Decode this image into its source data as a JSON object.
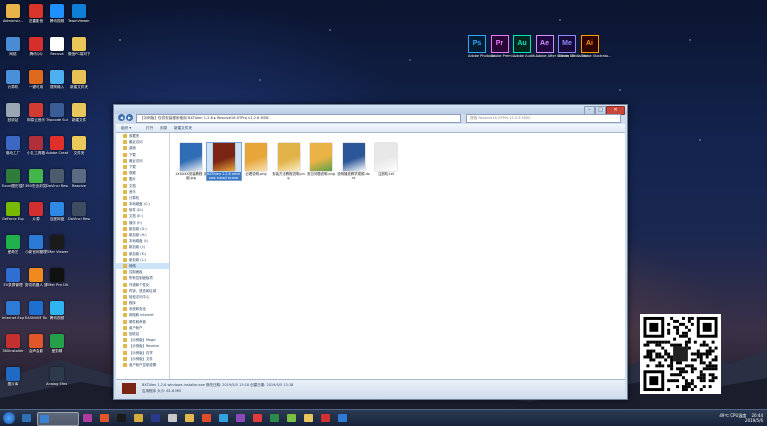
{
  "desktop": {
    "icons": [
      {
        "label": "Administr...",
        "color": "#e8b44a"
      },
      {
        "label": "迅雷影音",
        "color": "#d8342a"
      },
      {
        "label": "腾讯视频",
        "color": "#1e90ff"
      },
      {
        "label": "TeamViewer 14",
        "color": "#0e7fd6"
      },
      {
        "label": "网络",
        "color": "#4b8bd4"
      },
      {
        "label": "腾讯QQ",
        "color": "#d62d2d"
      },
      {
        "label": "Recuva",
        "color": "#ffffff"
      },
      {
        "label": "微信PC端可下载",
        "color": "#e8c657"
      },
      {
        "label": "计算机",
        "color": "#4a90d9"
      },
      {
        "label": "一键可用",
        "color": "#e06a1c"
      },
      {
        "label": "搜狗输入",
        "color": "#4fb0f0"
      },
      {
        "label": "新建文件夹",
        "color": "#e7c156"
      },
      {
        "label": "回收站",
        "color": "#9aa6b4"
      },
      {
        "label": "网易云音乐",
        "color": "#d13b32"
      },
      {
        "label": "Tripcode Suite 12.1...",
        "color": "#3a5d96"
      },
      {
        "label": "新建文件",
        "color": "#e8c65e"
      },
      {
        "label": "驱动工厂",
        "color": "#3a68c4"
      },
      {
        "label": "小扎工具箱",
        "color": "#b0303a"
      },
      {
        "label": "Adobe Creati...",
        "color": "#e0302c"
      },
      {
        "label": "文件夹",
        "color": "#eac85a"
      },
      {
        "label": "Excel图形插件",
        "color": "#2f7d3b"
      },
      {
        "label": "360安全浏览器",
        "color": "#43b649"
      },
      {
        "label": "DaVinci Resolve",
        "color": "#4e5b6d"
      },
      {
        "label": "Resolve",
        "color": "#5b6b82"
      },
      {
        "label": "GeForce Experience",
        "color": "#76b900"
      },
      {
        "label": "片源",
        "color": "#d23030"
      },
      {
        "label": "百度网盘",
        "color": "#2f8ae6"
      },
      {
        "label": "DaVinci Resol...",
        "color": "#3d4c60"
      },
      {
        "label": "爱奇艺",
        "color": "#20b14a"
      },
      {
        "label": "小新官网管理",
        "color": "#2b7bd6"
      },
      {
        "label": "TMer Viewer...",
        "color": "#1b1b1b"
      },
      {
        "label": "",
        "color": "#00000000"
      },
      {
        "label": "EV录屏管理",
        "color": "#2f6fd1"
      },
      {
        "label": "剪切机器人 媒体下载",
        "color": "#f08a1f"
      },
      {
        "label": "TMer Pro Ultimate",
        "color": "#111111"
      },
      {
        "label": "",
        "color": "#00000000"
      },
      {
        "label": "Internet Explorer",
        "color": "#2d7bd5"
      },
      {
        "label": "EASNVIM Tools Lite",
        "color": "#1d6fd0"
      },
      {
        "label": "腾讯视频",
        "color": "#2fb4f0"
      },
      {
        "label": "",
        "color": "#00000000"
      },
      {
        "label": "360Installer",
        "color": "#c33030"
      },
      {
        "label": "会声会影",
        "color": "#e2572a"
      },
      {
        "label": "爱剪辑",
        "color": "#24a04a"
      },
      {
        "label": "",
        "color": "#00000000"
      },
      {
        "label": "图片库",
        "color": "#1f6bc4"
      },
      {
        "label": "",
        "color": "#00000000"
      },
      {
        "label": "Analog Efex Pro 2",
        "color": "#2d3a4e"
      }
    ],
    "adobe": [
      {
        "abbr": "Ps",
        "label": "Adobe Photosh...",
        "bg": "#001d34",
        "fg": "#31a8ff"
      },
      {
        "abbr": "Pr",
        "label": "Adobe Premi...",
        "bg": "#2a0634",
        "fg": "#ea77ff"
      },
      {
        "abbr": "Au",
        "label": "Adobe Auditi...",
        "bg": "#00281f",
        "fg": "#00e4bb"
      },
      {
        "abbr": "Ae",
        "label": "Adobe After Effects CC ...",
        "bg": "#1f0840",
        "fg": "#d291ff"
      },
      {
        "abbr": "Me",
        "label": "Adobe Media Enc...",
        "bg": "#190b39",
        "fg": "#8f89ff"
      },
      {
        "abbr": "Ai",
        "label": "Adobe Illustrato...",
        "bg": "#330000",
        "fg": "#ff9a00"
      }
    ]
  },
  "explorer": {
    "title": "【示例版】仅供安装程序使用 BXTAlen 1.2.6 ▸ Resolve 16 XTPro V1.2.6 MSN",
    "address": "【示例版】仅供安装程序使用 BXTAlen 1.2.6 ▸ Resolve16 XTPro v1.2.6 MSN",
    "search_placeholder": "搜索 Resolve16 XTPro v1.2.6 MSN",
    "toolbar": [
      "组织 ▾",
      "打开",
      "刻录",
      "新建文件夹"
    ],
    "nav": [
      {
        "label": "收藏夹",
        "sel": false
      },
      {
        "label": "最近访问",
        "sel": false
      },
      {
        "label": "桌面",
        "sel": false
      },
      {
        "label": "下载",
        "sel": false
      },
      {
        "label": "最近访问",
        "sel": false
      },
      {
        "label": "下载",
        "sel": false
      },
      {
        "label": "视频",
        "sel": false
      },
      {
        "label": "图片",
        "sel": false
      },
      {
        "label": "文档",
        "sel": false
      },
      {
        "label": "音乐",
        "sel": false
      },
      {
        "label": "计算机",
        "sel": false
      },
      {
        "label": "本地磁盘 (C:)",
        "sel": false
      },
      {
        "label": "软件 (D:)",
        "sel": false
      },
      {
        "label": "文档 (E:)",
        "sel": false
      },
      {
        "label": "娱乐 (F:)",
        "sel": false
      },
      {
        "label": "新加卷 (G:)",
        "sel": false
      },
      {
        "label": "新加卷 (H:)",
        "sel": false
      },
      {
        "label": "本地磁盘 (I:)",
        "sel": false
      },
      {
        "label": "新加卷 (J:)",
        "sel": false
      },
      {
        "label": "新加卷 (K:)",
        "sel": false
      },
      {
        "label": "新加卷 (L:)",
        "sel": false
      },
      {
        "label": "网络",
        "sel": true
      },
      {
        "label": "控制面板",
        "sel": false
      },
      {
        "label": "所有控制面板项",
        "sel": false
      },
      {
        "label": "外观和个性化",
        "sel": false
      },
      {
        "label": "时钟、语言和区域",
        "sel": false
      },
      {
        "label": "轻松访问中心",
        "sel": false
      },
      {
        "label": "程序",
        "sel": false
      },
      {
        "label": "系统和安全",
        "sel": false
      },
      {
        "label": "网络和 Internet",
        "sel": false
      },
      {
        "label": "硬件和声音",
        "sel": false
      },
      {
        "label": "用户帐户",
        "sel": false
      },
      {
        "label": "回收站",
        "sel": false
      },
      {
        "label": "【示例版】Magic",
        "sel": false
      },
      {
        "label": "【示例版】Resolve",
        "sel": false
      },
      {
        "label": "【示例版】在学",
        "sel": false
      },
      {
        "label": "【示例版】文件",
        "sel": false
      },
      {
        "label": "用户帐户控制设置",
        "sel": false
      }
    ],
    "files": [
      {
        "name": "1XXXXX安装教程 详细.jpg",
        "thumb": "#2f6db6",
        "thumb2": "#f2f2f2",
        "sel": false
      },
      {
        "name": "BXTAlen 1.2.6 windows install er.exe",
        "thumb": "#7a2514",
        "thumb2": "#e8a63a",
        "sel": true
      },
      {
        "name": "必看说明.png",
        "thumb": "#e8a63a",
        "thumb2": "#f6e3b4",
        "sel": false
      },
      {
        "name": "安装方法教程说明.png",
        "thumb": "#e0b247",
        "thumb2": "#fbeec6",
        "sel": false
      },
      {
        "name": "常见问题说明.png",
        "thumb": "#e9b346",
        "thumb2": "#5da04a",
        "sel": false
      },
      {
        "name": "说明播放教学视频.docx",
        "thumb": "#2b579a",
        "thumb2": "#ffffff",
        "sel": false
      },
      {
        "name": "注册机.txt",
        "thumb": "#e8e8e8",
        "thumb2": "#ffffff",
        "sel": false
      }
    ],
    "details": {
      "line1": "BXTAlen 1.2.6 windows installer.exe   修改日期: 2019/5/5 13:18   创建日期: 2019/5/5 13:18",
      "line2": "应用程序   大小: 61.8 MB"
    }
  },
  "taskbar": {
    "items": [
      "#2f6fb5",
      "#3b82d6",
      "#b13b9f",
      "#e2572a",
      "#1a1a1a",
      "#d6ad3c",
      "#2a3a8a",
      "#c8c8c8",
      "#e0b84c",
      "#e24b2a",
      "#2fa4e0",
      "#8a4ab8",
      "#e13b3b",
      "#2b8a4c",
      "#7ac043",
      "#e8c65e",
      "#d23030",
      "#2d7bd5"
    ],
    "active_index": 1,
    "tray_temp": "49℃",
    "tray_cpu": "CPU温度",
    "time": "20:44",
    "date": "2019/5/6"
  }
}
